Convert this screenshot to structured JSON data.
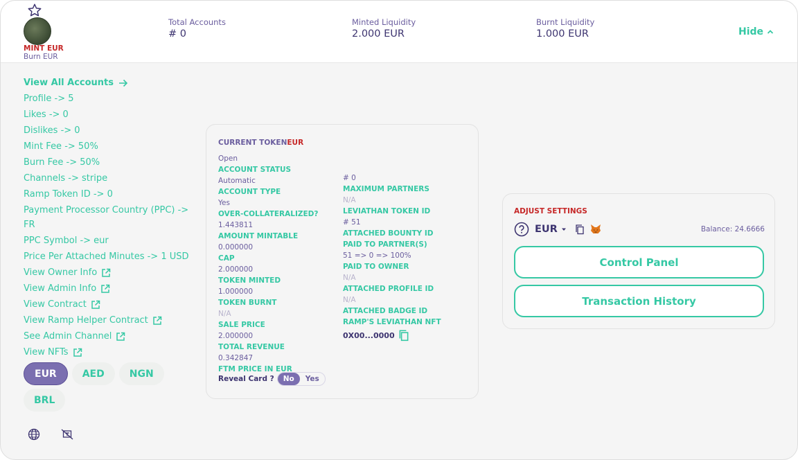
{
  "header": {
    "mint_label": "MINT EUR",
    "burn_label": "Burn EUR",
    "stats": [
      {
        "label": "Total Accounts",
        "value": "# 0"
      },
      {
        "label": "Minted Liquidity",
        "value": "2.000 EUR"
      },
      {
        "label": "Burnt Liquidity",
        "value": "1.000 EUR"
      }
    ],
    "hide_label": "Hide"
  },
  "sidebar": {
    "view_all": "View All Accounts",
    "items": [
      "Profile -> 5",
      "Likes -> 0",
      "Dislikes -> 0",
      "Mint Fee -> 50%",
      "Burn Fee -> 50%",
      "Channels -> stripe",
      "Ramp Token ID -> 0",
      "Payment Processor Country (PPC) -> FR",
      "PPC Symbol -> eur",
      "Price Per Attached Minutes -> 1 USD"
    ],
    "links": [
      "View Owner Info",
      "View Admin Info",
      "View Contract",
      "View Ramp Helper Contract",
      "See Admin Channel",
      "View NFTs"
    ],
    "currencies": [
      "EUR",
      "AED",
      "NGN",
      "BRL"
    ],
    "active_currency": "EUR"
  },
  "token_card": {
    "title": "CURRENT TOKEN",
    "token": "EUR",
    "left": [
      {
        "v": "Open"
      },
      {
        "k": "ACCOUNT STATUS"
      },
      {
        "v": "Automatic"
      },
      {
        "k": "ACCOUNT TYPE"
      },
      {
        "v": "Yes"
      },
      {
        "k": "OVER-COLLATERALIZED?"
      },
      {
        "v": "1.443811"
      },
      {
        "k": "AMOUNT MINTABLE"
      },
      {
        "v": "0.000000"
      },
      {
        "k": "CAP"
      },
      {
        "v": "2.000000"
      },
      {
        "k": "TOKEN MINTED"
      },
      {
        "v": "1.000000"
      },
      {
        "k": "TOKEN BURNT"
      },
      {
        "na": "N/A"
      },
      {
        "k": "SALE PRICE"
      },
      {
        "v": "2.000000"
      },
      {
        "k": "TOTAL REVENUE"
      },
      {
        "v": "0.342847"
      },
      {
        "k": "FTM PRICE IN EUR"
      }
    ],
    "right": [
      {
        "v": "# 0"
      },
      {
        "k": "MAXIMUM PARTNERS"
      },
      {
        "na": "N/A"
      },
      {
        "k": "LEVIATHAN TOKEN ID"
      },
      {
        "v": "# 51"
      },
      {
        "k": "ATTACHED BOUNTY ID"
      },
      {
        "k": "PAID TO PARTNER(S)"
      },
      {
        "v": "51 => 0 => 100%"
      },
      {
        "k": "PAID TO OWNER"
      },
      {
        "na": "N/A"
      },
      {
        "k": "ATTACHED PROFILE ID"
      },
      {
        "na": "N/A"
      },
      {
        "k": "ATTACHED BADGE ID"
      },
      {
        "k": "RAMP'S LEVIATHAN NFT"
      }
    ],
    "address": "0X00...0000",
    "reveal_label": "Reveal Card ?",
    "reveal_no": "No",
    "reveal_yes": "Yes"
  },
  "settings": {
    "title": "ADJUST SETTINGS",
    "currency": "EUR",
    "balance": "Balance: 24.6666",
    "control_panel": "Control Panel",
    "transaction_history": "Transaction History"
  },
  "colors": {
    "accent": "#35c8a4",
    "purple": "#6a5d9e",
    "red": "#c62828",
    "active_chip": "#7b6fb0"
  }
}
